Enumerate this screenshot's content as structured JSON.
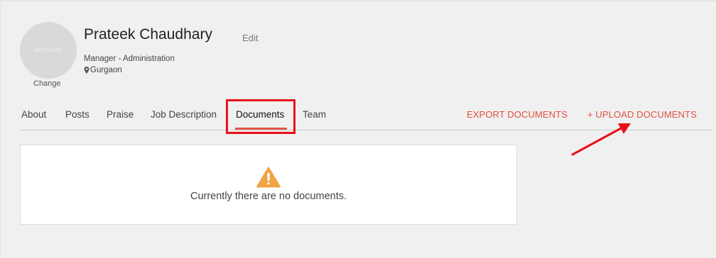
{
  "profile": {
    "avatar_text": "NO PHOTO",
    "change_label": "Change",
    "name": "Prateek Chaudhary",
    "edit_label": "Edit",
    "designation": "Manager - Administration",
    "location": "Gurgaon"
  },
  "tabs": [
    {
      "label": "About"
    },
    {
      "label": "Posts"
    },
    {
      "label": "Praise"
    },
    {
      "label": "Job Description"
    },
    {
      "label": "Documents",
      "active": true
    },
    {
      "label": "Team"
    }
  ],
  "actions": {
    "export_label": "EXPORT DOCUMENTS",
    "upload_label": "+ UPLOAD DOCUMENTS"
  },
  "documents": {
    "empty_message": "Currently there are no documents."
  },
  "colors": {
    "accent": "#e0503f",
    "annotation": "#e8101b",
    "warning": "#f0a442"
  },
  "icons": [
    "map-pin-icon",
    "warning-icon",
    "annotation-arrow"
  ]
}
